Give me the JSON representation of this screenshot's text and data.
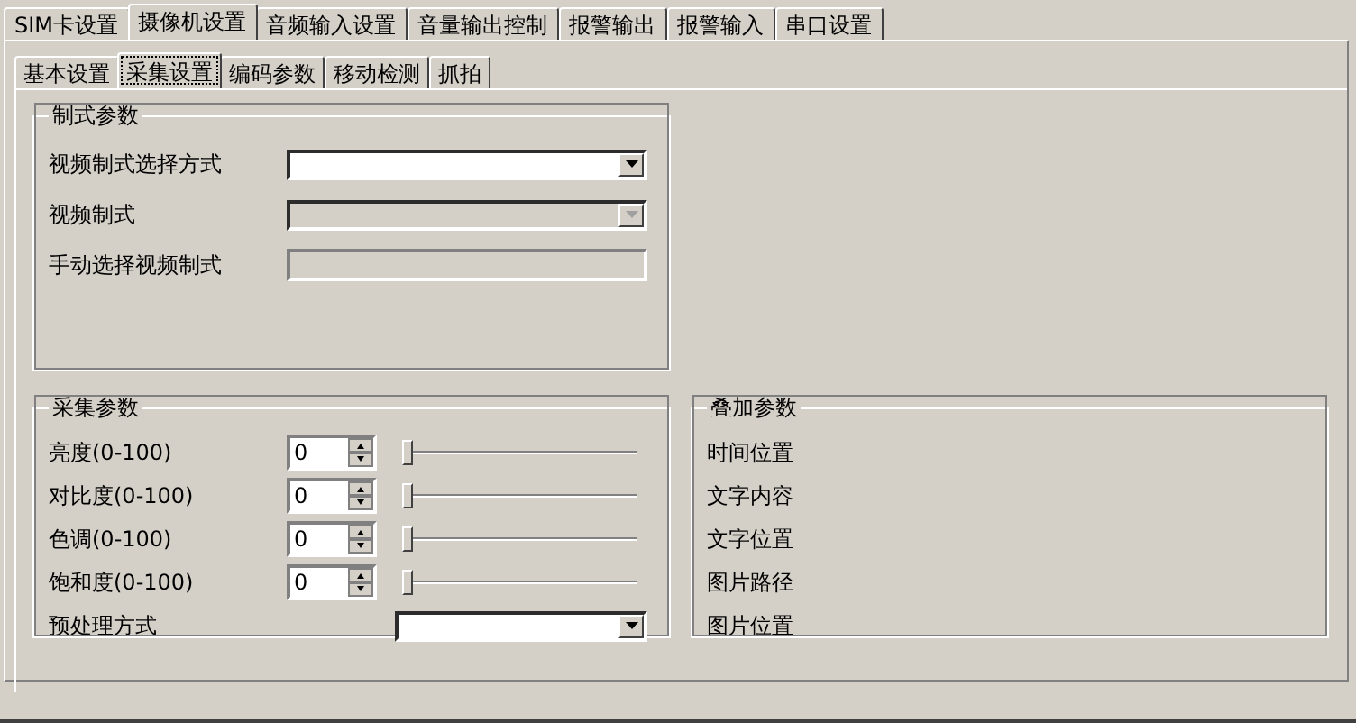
{
  "tabs": [
    {
      "label": "SIM卡设置",
      "selected": false
    },
    {
      "label": "摄像机设置",
      "selected": true
    },
    {
      "label": "音频输入设置",
      "selected": false
    },
    {
      "label": "音量输出控制",
      "selected": false
    },
    {
      "label": "报警输出",
      "selected": false
    },
    {
      "label": "报警输入",
      "selected": false
    },
    {
      "label": "串口设置",
      "selected": false
    }
  ],
  "sub_tabs": [
    {
      "label": "基本设置",
      "selected": false
    },
    {
      "label": "采集设置",
      "selected": true
    },
    {
      "label": "编码参数",
      "selected": false
    },
    {
      "label": "移动检测",
      "selected": false
    },
    {
      "label": "抓拍",
      "selected": false
    }
  ],
  "standard_group": {
    "title": "制式参数",
    "rows": [
      {
        "label": "视频制式选择方式",
        "kind": "dropdown",
        "disabled": false
      },
      {
        "label": "视频制式",
        "kind": "dropdown",
        "disabled": true
      },
      {
        "label": "手动选择视频制式",
        "kind": "text",
        "disabled": true
      }
    ]
  },
  "capture_group": {
    "title": "采集参数",
    "rows": [
      {
        "label": "亮度(0-100)",
        "kind": "slider",
        "value": "0",
        "level": 0
      },
      {
        "label": "对比度(0-100)",
        "kind": "slider",
        "value": "0",
        "level": 0
      },
      {
        "label": "色调(0-100)",
        "kind": "slider",
        "value": "0",
        "level": 0
      },
      {
        "label": "饱和度(0-100)",
        "kind": "slider",
        "value": "0",
        "level": 0
      },
      {
        "label": "预处理方式",
        "kind": "dropdown"
      }
    ]
  },
  "overlay_group": {
    "title": "叠加参数",
    "rows": [
      {
        "label": "时间位置"
      },
      {
        "label": "文字内容"
      },
      {
        "label": "文字位置"
      },
      {
        "label": "图片路径"
      },
      {
        "label": "图片位置"
      }
    ]
  }
}
